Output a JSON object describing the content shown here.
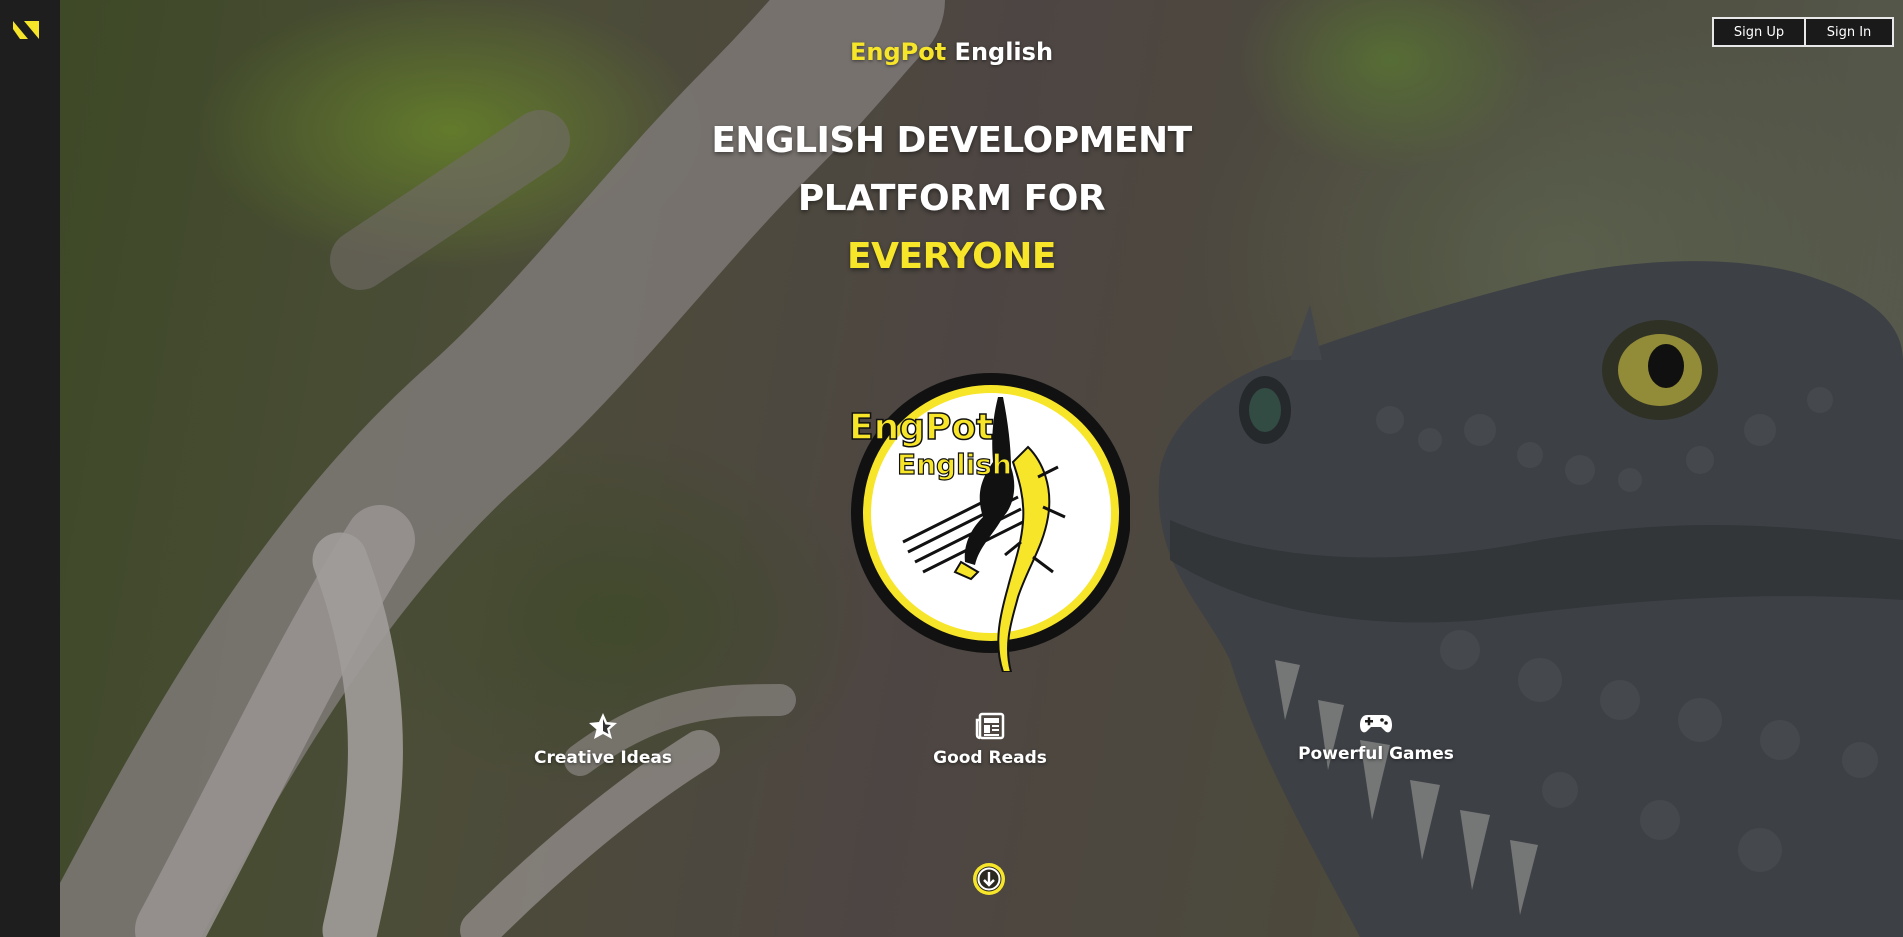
{
  "brand": {
    "name_accent": "EngPot",
    "name_rest": "English"
  },
  "auth": {
    "sign_up": "Sign Up",
    "sign_in": "Sign In"
  },
  "headline": {
    "line1": "ENGLISH DEVELOPMENT",
    "line2": "PLATFORM FOR",
    "line3": "EVERYONE"
  },
  "emblem": {
    "text_line1": "EngPot",
    "text_line2": "English"
  },
  "features": [
    {
      "icon": "star-icon",
      "label": "Creative Ideas"
    },
    {
      "icon": "newspaper-icon",
      "label": "Good Reads"
    },
    {
      "icon": "gamepad-icon",
      "label": "Powerful Games"
    }
  ],
  "scroll": {
    "icon": "arrow-down-circle-icon"
  },
  "colors": {
    "accent": "#f7e52a",
    "sidebar": "#1e1e1e",
    "button_bg": "#1a1a1a"
  }
}
